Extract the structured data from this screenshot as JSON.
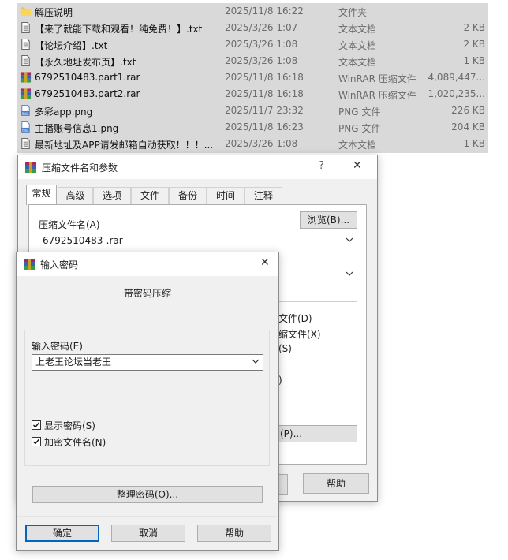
{
  "files": [
    {
      "icon": "folder-icon",
      "name": "解压说明",
      "date": "2025/11/8 16:22",
      "type": "文件夹",
      "size": ""
    },
    {
      "icon": "text-file-icon",
      "name": "【来了就能下载和观看！纯免费！】.txt",
      "date": "2025/3/26 1:07",
      "type": "文本文档",
      "size": "2 KB"
    },
    {
      "icon": "text-file-icon",
      "name": "【论坛介绍】.txt",
      "date": "2025/3/26 1:08",
      "type": "文本文档",
      "size": "2 KB"
    },
    {
      "icon": "text-file-icon",
      "name": "【永久地址发布页】.txt",
      "date": "2025/3/26 1:08",
      "type": "文本文档",
      "size": "1 KB"
    },
    {
      "icon": "rar-archive-icon",
      "name": "6792510483.part1.rar",
      "date": "2025/11/8 16:18",
      "type": "WinRAR 压缩文件",
      "size": "4,089,447..."
    },
    {
      "icon": "rar-archive-icon",
      "name": "6792510483.part2.rar",
      "date": "2025/11/8 16:18",
      "type": "WinRAR 压缩文件",
      "size": "1,020,235..."
    },
    {
      "icon": "png-file-icon",
      "name": "多彩app.png",
      "date": "2025/11/7 23:32",
      "type": "PNG 文件",
      "size": "226 KB"
    },
    {
      "icon": "png-file-icon",
      "name": "主播账号信息1.png",
      "date": "2025/11/8 16:23",
      "type": "PNG 文件",
      "size": "204 KB"
    },
    {
      "icon": "text-file-icon",
      "name": "最新地址及APP请发邮箱自动获取！！！...",
      "date": "2025/3/26 1:08",
      "type": "文本文档",
      "size": "1 KB"
    }
  ],
  "archive_dialog": {
    "title": "压缩文件名和参数",
    "help_glyph": "?",
    "close_glyph": "✕",
    "tabs": [
      "常规",
      "高级",
      "选项",
      "文件",
      "备份",
      "时间",
      "注释"
    ],
    "archive_name_label": "压缩文件名(A)",
    "browse_label": "浏览(B)...",
    "archive_name_value": "6792510483-.rar",
    "partial_opts": [
      "文件(D)",
      "缩文件(X)",
      "(S)",
      ")"
    ],
    "partial_button": "(P)...",
    "help_button": "帮助"
  },
  "password_dialog": {
    "title": "输入密码",
    "close_glyph": "✕",
    "heading": "带密码压缩",
    "password_label": "输入密码(E)",
    "password_value": "上老王论坛当老王",
    "show_password_label": "显示密码(S)",
    "show_password_checked": true,
    "encrypt_names_label": "加密文件名(N)",
    "encrypt_names_checked": true,
    "organize_button": "整理密码(O)...",
    "ok_button": "确定",
    "cancel_button": "取消",
    "help_button": "帮助"
  },
  "colors": {
    "selection": "#d9d9d9",
    "dialog_bg": "#f0f0f0",
    "ok_border": "#0067c0"
  }
}
